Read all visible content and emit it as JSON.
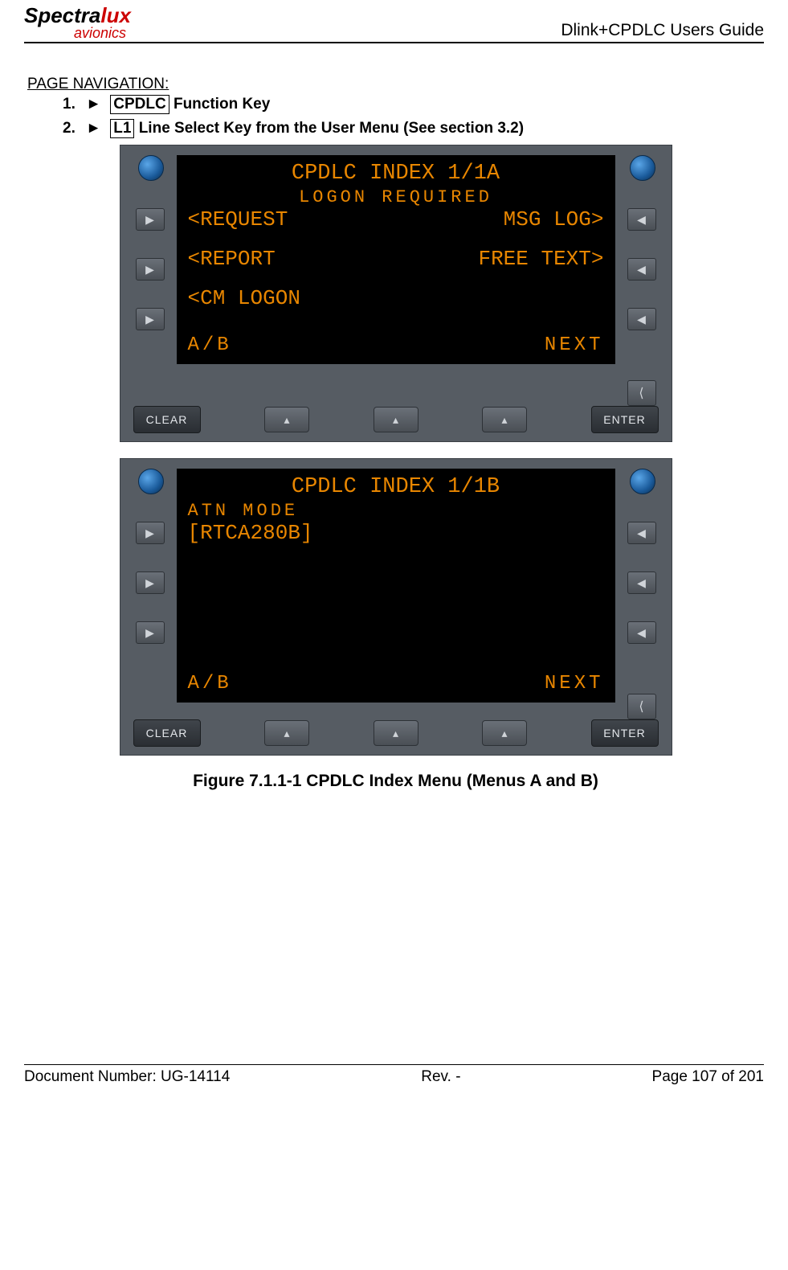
{
  "header": {
    "logo_black": "Spectra",
    "logo_red_main": "lux",
    "logo_sub": "avionics",
    "right": "Dlink+CPDLC Users Guide"
  },
  "nav": {
    "heading": "PAGE NAVIGATION:",
    "item1_num": "1.",
    "item1_box": "CPDLC",
    "item1_tail": " Function Key",
    "item2_num": "2.",
    "item2_box": "L1",
    "item2_tail": " Line Select Key from the User Menu (See section 3.2)"
  },
  "screenA": {
    "title": "CPDLC INDEX  1/1A",
    "sub": "LOGON REQUIRED",
    "r1l": "<REQUEST",
    "r1r": "MSG LOG>",
    "r2l": "<REPORT",
    "r2r": "FREE TEXT>",
    "r3l": "<CM LOGON",
    "fl": "A/B",
    "fr": "NEXT"
  },
  "screenB": {
    "title": "CPDLC INDEX  1/1B",
    "sub": "ATN MODE",
    "r1l": "[RTCA280B]",
    "fl": "A/B",
    "fr": "NEXT"
  },
  "buttons": {
    "clear": "CLEAR",
    "enter": "ENTER"
  },
  "caption": "Figure 7.1.1-1 CPDLC Index Menu (Menus A and B)",
  "footer": {
    "left": "Document Number:  UG-14114",
    "mid": "Rev. -",
    "right": "Page 107 of 201"
  }
}
